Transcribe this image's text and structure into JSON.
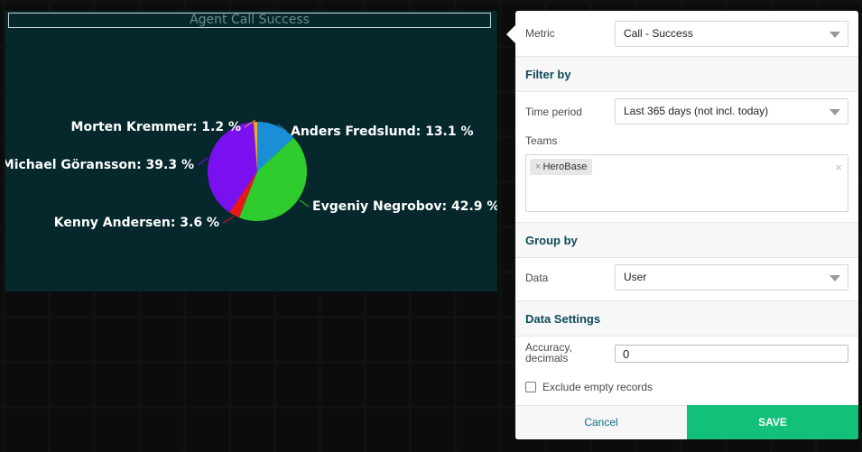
{
  "widget": {
    "title": "Agent Call Success"
  },
  "chart_data": {
    "type": "pie",
    "title": "Agent Call Success",
    "slices": [
      {
        "name": "Anders Fredslund",
        "value": 13.1,
        "label": "Anders Fredslund: 13.1 %",
        "color": "#1a8fd6"
      },
      {
        "name": "Evgeniy Negrobov",
        "value": 42.9,
        "label": "Evgeniy Negrobov: 42.9 %",
        "color": "#2ecc2e"
      },
      {
        "name": "Kenny Andersen",
        "value": 3.6,
        "label": "Kenny Andersen: 3.6 %",
        "color": "#e81818"
      },
      {
        "name": "Michael Göransson",
        "value": 39.3,
        "label": "Michael Göransson: 39.3 %",
        "color": "#7a10f0"
      },
      {
        "name": "Morten Kremmer",
        "value": 1.2,
        "label": "Morten Kremmer: 1.2 %",
        "color": "#f5a623"
      }
    ]
  },
  "panel": {
    "metric": {
      "label": "Metric",
      "value": "Call - Success"
    },
    "filter_section": "Filter by",
    "time_period": {
      "label": "Time period",
      "value": "Last 365 days (not incl. today)"
    },
    "teams": {
      "label": "Teams",
      "tags": [
        "HeroBase"
      ],
      "tag_remove": "×",
      "clear": "×"
    },
    "group_section": "Group by",
    "data": {
      "label": "Data",
      "value": "User"
    },
    "data_settings_section": "Data Settings",
    "accuracy": {
      "label_line1": "Accuracy,",
      "label_line2": "decimals",
      "value": "0"
    },
    "exclude_empty": {
      "label": "Exclude empty records",
      "checked": false
    },
    "cancel_label": "Cancel",
    "save_label": "SAVE"
  },
  "colors": {
    "widget_bg": "#06282c",
    "accent_green": "#13c07a",
    "section_text": "#0d4a59"
  }
}
